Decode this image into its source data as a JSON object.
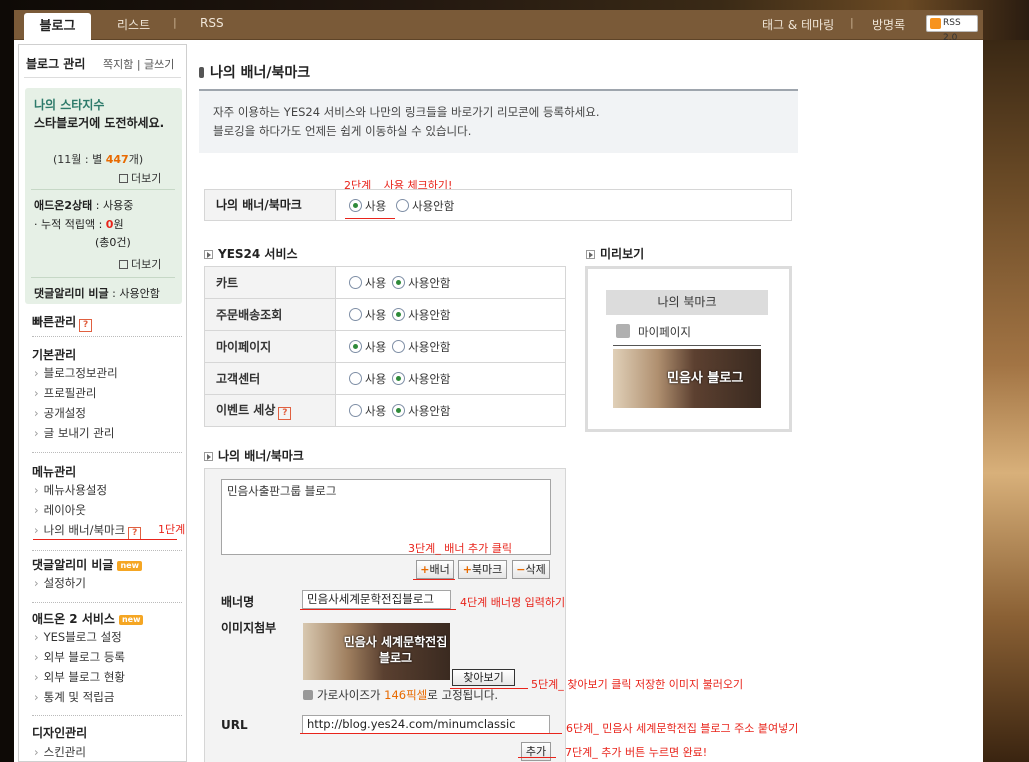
{
  "topnav": {
    "active_tab": "블로그",
    "tabs": [
      "리스트",
      "RSS"
    ],
    "right_links": [
      "태그 & 테마링",
      "방명록"
    ],
    "rss_badge": "RSS 2.0"
  },
  "sidebar": {
    "title": "블로그 관리",
    "title_links": "쪽지함 | 글쓰기",
    "star": {
      "heading": "나의 스타지수",
      "text": "스타블로거에 도전하세요.",
      "stat_prefix": "(11월 : 별 ",
      "stat_value": "447",
      "stat_suffix": "개)",
      "more": "더보기"
    },
    "addon": {
      "status_label": "애드온2상태",
      "status_value": " : 사용중",
      "points_label": "· 누적 적립액 : ",
      "points_value": "0",
      "points_suffix": "원",
      "count_prefix": "(총",
      "count_value": "0",
      "count_suffix": "건)",
      "more": "더보기"
    },
    "comment_alarm_label": "댓글알리미 비글",
    "comment_alarm_value": " : 사용안함",
    "quick": "빠른관리",
    "basic": {
      "heading": "기본관리",
      "items": [
        "블로그정보관리",
        "프로필관리",
        "공개설정",
        "글 보내기 관리"
      ]
    },
    "menu": {
      "heading": "메뉴관리",
      "items": [
        "메뉴사용설정",
        "레이아웃",
        "나의 배너/북마크"
      ]
    },
    "beagle": {
      "heading": "댓글알리미 비글",
      "badge": "new",
      "items": [
        "설정하기"
      ]
    },
    "addon2": {
      "heading": "애드온 2 서비스",
      "badge": "new",
      "items": [
        "YES블로그 설정",
        "외부 블로그 등록",
        "외부 블로그 현황",
        "통계 및 적립금"
      ]
    },
    "design": {
      "heading": "디자인관리",
      "items": [
        "스킨관리"
      ]
    }
  },
  "main": {
    "title": "나의 배너/북마크",
    "intro_line1": "자주 이용하는 YES24 서비스와 나만의 링크들을 바로가기 리모콘에 등록하세요.",
    "intro_line2": "블로깅을 하다가도 언제든 쉽게 이동하실 수 있습니다.",
    "use_row": {
      "label": "나의 배너/북마크",
      "on": "사용",
      "off": "사용안함",
      "selected": "사용"
    },
    "services_heading": "YES24 서비스",
    "services": [
      {
        "name": "카트",
        "selected": "사용안함"
      },
      {
        "name": "주문배송조회",
        "selected": "사용안함"
      },
      {
        "name": "마이페이지",
        "selected": "사용"
      },
      {
        "name": "고객센터",
        "selected": "사용안함"
      },
      {
        "name": "이벤트 세상",
        "selected": "사용안함"
      }
    ],
    "radio_on": "사용",
    "radio_off": "사용안함",
    "preview": {
      "heading": "미리보기",
      "box_title": "나의 북마크",
      "item": "마이페이지",
      "banner_text": "민음사 블로그"
    },
    "bookmark": {
      "heading": "나의 배너/북마크",
      "list_text": "민음사출판그룹 블로그",
      "btn_banner": "배너",
      "btn_bookmark": "북마크",
      "btn_delete": "삭제",
      "banner_name_label": "배너명",
      "banner_name_value": "민음사세계문학전집블로그",
      "image_label": "이미지첨부",
      "image_text": "민음사 세계문학전집 블로그",
      "browse_button": "찾아보기",
      "note_prefix": "가로사이즈가 ",
      "note_value": "146픽셀",
      "note_suffix": "로 고정됩니다.",
      "url_label": "URL",
      "url_value": "http://blog.yes24.com/minumclassic",
      "add_button": "추가"
    }
  },
  "annotations": {
    "step1": "1단계",
    "step2": "2단계 _ 사용 체크하기!",
    "step3": "3단계_ 배너 추가 클릭",
    "step4": "4단계 배너명 입력하기",
    "step5": "5단계_ 찾아보기 클릭 저장한 이미지 불러오기",
    "step6": "6단계_ 민음사 세계문학전집 블로그 주소 붙여넣기",
    "step7": "7단계_ 추가 버튼 누르면 완료!"
  },
  "colors": {
    "accent_red": "#e8241b",
    "nav_brown": "#7a5a38",
    "star_green": "#2d7a6a",
    "highlight_orange": "#e86a00"
  }
}
